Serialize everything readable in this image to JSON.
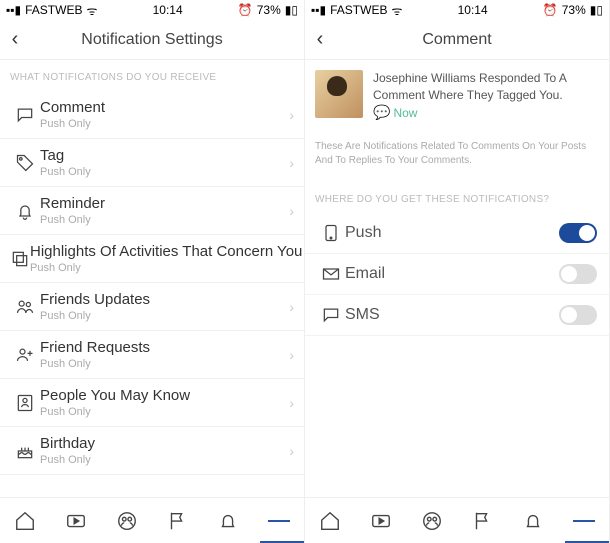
{
  "status": {
    "carrier": "FASTWEB",
    "time": "10:14",
    "battery": "73%"
  },
  "left": {
    "title": "Notification Settings",
    "section": "WHAT NOTIFICATIONS DO YOU RECEIVE",
    "items": [
      {
        "title": "Comment",
        "sub": "Push Only"
      },
      {
        "title": "Tag",
        "sub": "Push Only"
      },
      {
        "title": "Reminder",
        "sub": "Push Only"
      },
      {
        "title": "Highlights Of Activities That Concern You",
        "sub": "Push Only"
      },
      {
        "title": "Friends Updates",
        "sub": "Push Only"
      },
      {
        "title": "Friend Requests",
        "sub": "Push Only"
      },
      {
        "title": "People You May Know",
        "sub": "Push Only"
      },
      {
        "title": "Birthday",
        "sub": "Push Only"
      }
    ]
  },
  "right": {
    "title": "Comment",
    "notif_text": "Josephine Williams Responded To A Comment Where They Tagged You.",
    "notif_time": "Now",
    "desc": "These Are Notifications Related To Comments On Your Posts And To Replies To Your Comments.",
    "section": "WHERE DO YOU GET THESE NOTIFICATIONS?",
    "toggles": [
      {
        "label": "Push",
        "on": true
      },
      {
        "label": "Email",
        "on": false
      },
      {
        "label": "SMS",
        "on": false
      }
    ]
  }
}
